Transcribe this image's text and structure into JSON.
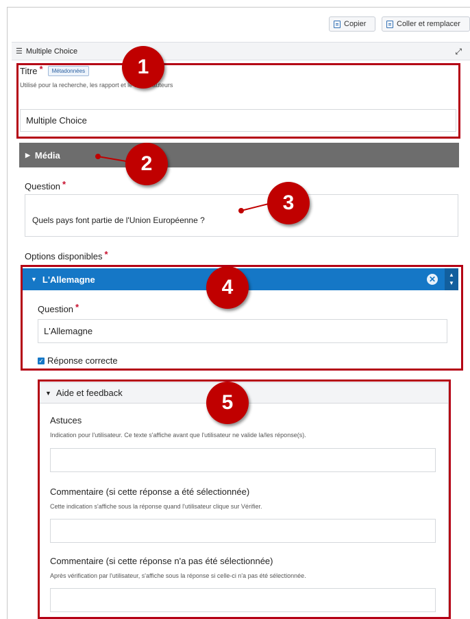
{
  "toolbar": {
    "copy_label": "Copier",
    "paste_label": "Coller et remplacer"
  },
  "widget": {
    "title": "Multiple Choice"
  },
  "title_field": {
    "label": "Titre",
    "required_mark": "*",
    "tag": "Métadonnées",
    "hint": "Utilisé pour la recherche, les rapport et le droit d'auteurs",
    "value": "Multiple Choice"
  },
  "media": {
    "label": "Média"
  },
  "question": {
    "label": "Question",
    "required_mark": "*",
    "value": "Quels pays font partie de l'Union Européenne ?"
  },
  "options": {
    "label": "Options disponibles",
    "required_mark": "*",
    "items": [
      {
        "title": "L'Allemagne",
        "question_label": "Question",
        "question_value": "L'Allemagne",
        "correct_label": "Réponse correcte",
        "correct": true
      }
    ]
  },
  "feedback": {
    "title": "Aide et feedback",
    "sections": [
      {
        "label": "Astuces",
        "hint": "Indication pour l'utilisateur. Ce texte s'affiche avant que l'utilisateur ne valide la/les réponse(s).",
        "value": ""
      },
      {
        "label": "Commentaire (si cette réponse a été sélectionnée)",
        "hint": "Cette indication s'affiche sous la réponse quand l'utilisateur clique sur Vérifier.",
        "value": ""
      },
      {
        "label": "Commentaire (si cette réponse n'a pas été sélectionnée)",
        "hint": "Après vérification par l'utilisateur, s'affiche sous la réponse si celle-ci n'a pas été sélectionnée.",
        "value": ""
      }
    ]
  },
  "annotations": [
    "1",
    "2",
    "3",
    "4",
    "5"
  ],
  "colors": {
    "highlight": "#b40014",
    "badge": "#c00000",
    "option_bar": "#1577c6",
    "media_bar": "#6d6d6d"
  }
}
